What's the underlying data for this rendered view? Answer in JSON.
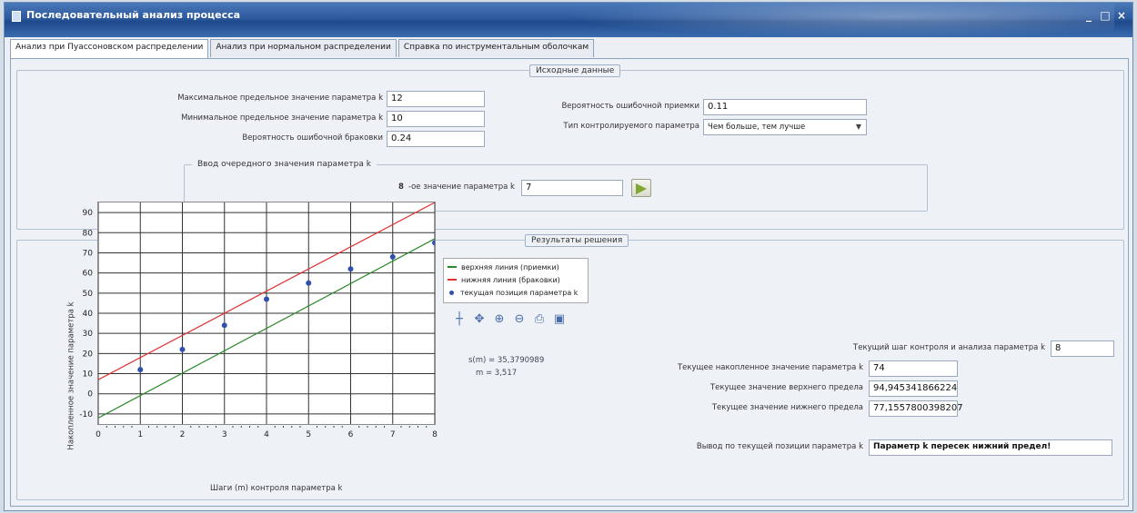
{
  "window": {
    "title": "Последовательный анализ процесса",
    "controls": {
      "minimize": "_",
      "maximize": "□",
      "close": "×"
    }
  },
  "tabs": [
    {
      "label": "Анализ при Пуассоновском распределении",
      "active": true
    },
    {
      "label": "Анализ при нормальном распределении",
      "active": false
    },
    {
      "label": "Справка по инструментальным оболочкам",
      "active": false
    }
  ],
  "input_group": {
    "title": "Исходные данные",
    "max_label": "Максимальное предельное значение параметра k",
    "max_value": "12",
    "min_label": "Минимальное предельное значение параметра k",
    "min_value": "10",
    "reject_prob_label": "Вероятность ошибочной браковки",
    "reject_prob_value": "0.24",
    "accept_prob_label": "Вероятность ошибочной приемки",
    "accept_prob_value": "0.11",
    "param_type_label": "Тип контролируемого параметра",
    "param_type_value": "Чем больше, тем лучше"
  },
  "entry_group": {
    "title": "Ввод очередного значения параметра k",
    "step_number": "8",
    "value_label": "-ое значение параметра k",
    "value": "7",
    "apply_icon": "green-arrow-icon"
  },
  "results_group": {
    "title": "Результаты решения",
    "step_label": "Текущий шаг контроля и анализа параметра k",
    "step_value": "8",
    "accum_label": "Текущее накопленное значение параметра k",
    "accum_value": "74",
    "upper_label": "Текущее значение верхнего предела",
    "upper_value": "94,945341866224",
    "lower_label": "Текущее значение нижнего предела",
    "lower_value": "77,1557800398207",
    "conclusion_label": "Вывод по текущей позиции параметра k",
    "conclusion_value": "Параметр k пересек нижний предел!"
  },
  "chart_annotation": {
    "line1": "s(m) = 35,3790989",
    "line2": "m = 3,517"
  },
  "toolbar": [
    "crosshair-icon",
    "pan-icon",
    "zoom-in-icon",
    "zoom-out-icon",
    "print-icon",
    "save-icon"
  ],
  "chart_data": {
    "type": "line",
    "xlabel": "Шаги (m) контроля параметра k",
    "ylabel": "Накопленное значение параметра k",
    "xlim": [
      0,
      8
    ],
    "ylim": [
      -15,
      95
    ],
    "xticks": [
      0,
      1,
      2,
      3,
      4,
      5,
      6,
      7,
      8
    ],
    "yticks": [
      -10,
      0,
      10,
      20,
      30,
      40,
      50,
      60,
      70,
      80,
      90
    ],
    "grid": true,
    "legend_position": "right",
    "series": [
      {
        "name": "верхняя линия (приемки)",
        "type": "line",
        "color": "#2a8a2a",
        "x": [
          0,
          8
        ],
        "y": [
          -12,
          77
        ]
      },
      {
        "name": "нижняя линия (браковки)",
        "type": "line",
        "color": "#e03030",
        "x": [
          0,
          8
        ],
        "y": [
          7,
          95
        ]
      },
      {
        "name": "текущая позиция параметра k",
        "type": "scatter",
        "color": "#3050b0",
        "x": [
          1,
          2,
          3,
          4,
          5,
          6,
          7,
          8
        ],
        "y": [
          12,
          22,
          34,
          47,
          55,
          62,
          68,
          75
        ]
      }
    ]
  }
}
